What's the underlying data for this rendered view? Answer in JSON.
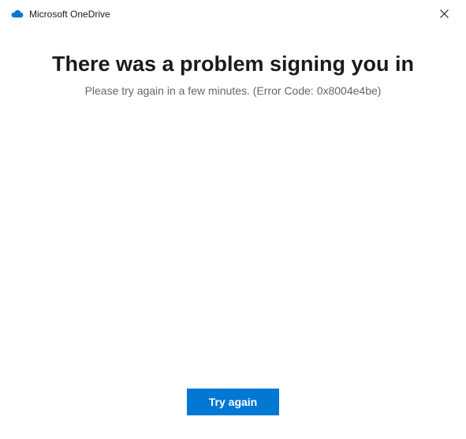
{
  "titlebar": {
    "app_name": "Microsoft OneDrive"
  },
  "content": {
    "heading": "There was a problem signing you in",
    "subtext": "Please try again in a few minutes. (Error Code: 0x8004e4be)"
  },
  "footer": {
    "primary_button_label": "Try again"
  },
  "colors": {
    "accent": "#0078d4",
    "cloud_icon": "#0078d4"
  }
}
